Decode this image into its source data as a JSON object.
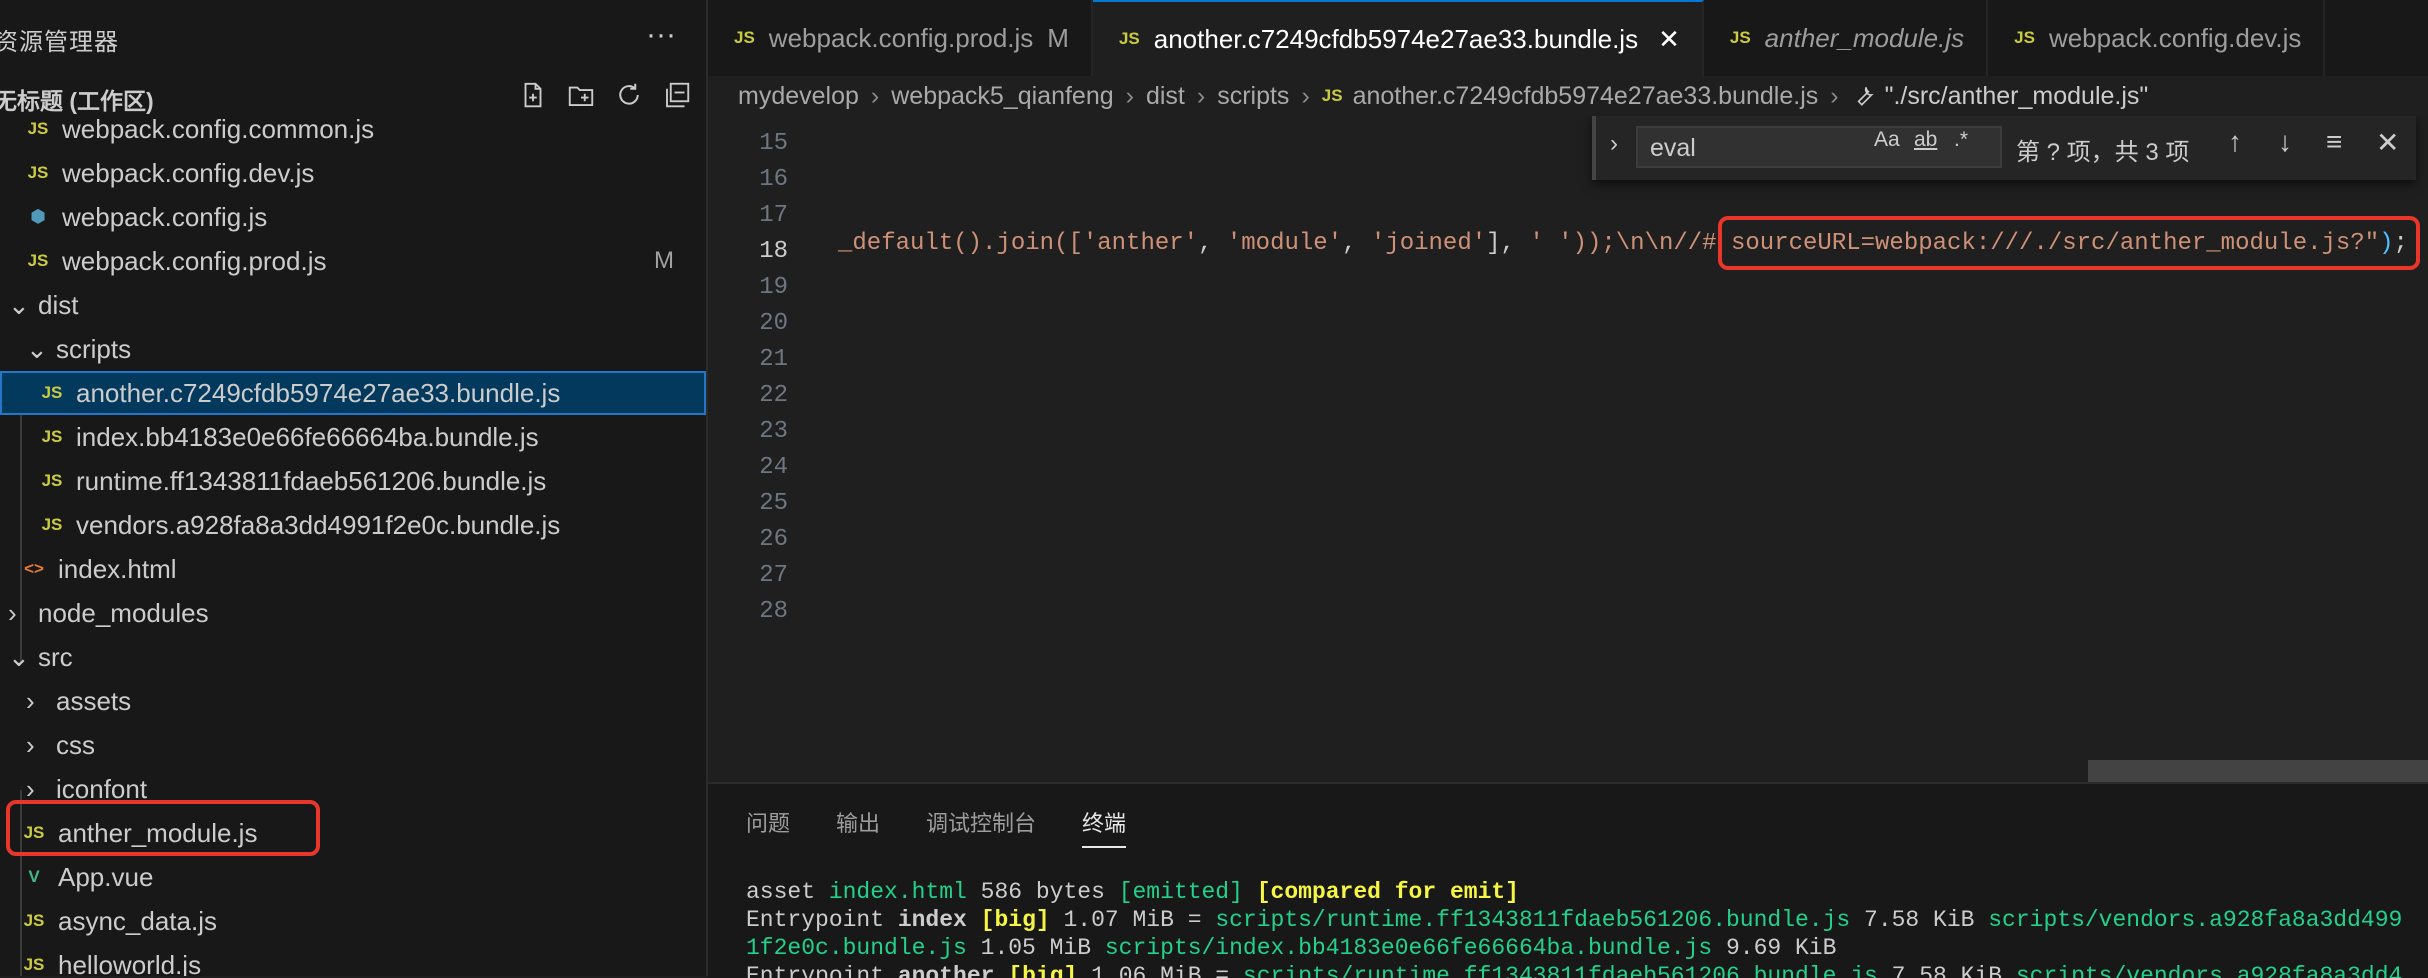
{
  "sidebar": {
    "title": "资源管理器",
    "more": "···",
    "workspace_label": "无标题 (工作区)",
    "items": [
      {
        "label": "webpack.config.common.js",
        "icon": "JS",
        "badge": ""
      },
      {
        "label": "webpack.config.dev.js",
        "icon": "JS",
        "badge": ""
      },
      {
        "label": "webpack.config.js",
        "icon": "gear",
        "badge": ""
      },
      {
        "label": "webpack.config.prod.js",
        "icon": "JS",
        "badge": "M"
      },
      {
        "label": "dist",
        "icon": "chevron-down",
        "badge": ""
      },
      {
        "label": "scripts",
        "icon": "chevron-down",
        "badge": ""
      },
      {
        "label": "another.c7249cfdb5974e27ae33.bundle.js",
        "icon": "JS",
        "badge": ""
      },
      {
        "label": "index.bb4183e0e66fe66664ba.bundle.js",
        "icon": "JS",
        "badge": ""
      },
      {
        "label": "runtime.ff1343811fdaeb561206.bundle.js",
        "icon": "JS",
        "badge": ""
      },
      {
        "label": "vendors.a928fa8a3dd4991f2e0c.bundle.js",
        "icon": "JS",
        "badge": ""
      },
      {
        "label": "index.html",
        "icon": "<>",
        "badge": ""
      },
      {
        "label": "node_modules",
        "icon": "chevron-right",
        "badge": ""
      },
      {
        "label": "src",
        "icon": "chevron-down",
        "badge": ""
      },
      {
        "label": "assets",
        "icon": "chevron-right",
        "badge": ""
      },
      {
        "label": "css",
        "icon": "chevron-right",
        "badge": ""
      },
      {
        "label": "iconfont",
        "icon": "chevron-right",
        "badge": ""
      },
      {
        "label": "anther_module.js",
        "icon": "JS",
        "badge": ""
      },
      {
        "label": "App.vue",
        "icon": "V",
        "badge": ""
      },
      {
        "label": "async_data.js",
        "icon": "JS",
        "badge": ""
      },
      {
        "label": "helloworld.js",
        "icon": "JS",
        "badge": ""
      }
    ]
  },
  "tabs": [
    {
      "label": "webpack.config.prod.js",
      "status": "M"
    },
    {
      "label": "another.c7249cfdb5974e27ae33.bundle.js",
      "close": "✕"
    },
    {
      "label": "anther_module.js"
    },
    {
      "label": "webpack.config.dev.js"
    }
  ],
  "breadcrumb": {
    "parts": [
      "mydevelop",
      "webpack5_qianfeng",
      "dist",
      "scripts"
    ],
    "file": "another.c7249cfdb5974e27ae33.bundle.js",
    "symbol": "\"./src/anther_module.js\""
  },
  "editor": {
    "line_numbers": [
      "15",
      "16",
      "17",
      "18",
      "19",
      "20",
      "21",
      "22",
      "23",
      "24",
      "25",
      "26",
      "27",
      "28"
    ],
    "code": {
      "part1": "_default().join([",
      "s1": "'anther'",
      "c1": ", ",
      "s2": "'module'",
      "c2": ", ",
      "s3": "'joined'",
      "c3": "], ",
      "s4": "' '",
      "c4": "));\\n\\n//# ",
      "highlight": "sourceURL=webpack:///./src/anther_module.js?\"",
      "end_paren": ")",
      "end": ";"
    }
  },
  "find": {
    "value": "eval",
    "case_label": "Aa",
    "word_label": "ab",
    "regex_label": ".*",
    "count": "第 ? 项，共 3 项"
  },
  "panel": {
    "tabs": [
      "问题",
      "输出",
      "调试控制台",
      "终端"
    ],
    "terminal": {
      "l1_a": "asset ",
      "l1_b": "index.html",
      "l1_c": " 586 bytes ",
      "l1_d": "[emitted]",
      "l1_e": " ",
      "l1_f": "[compared for emit]",
      "l2_a": "Entrypoint ",
      "l2_b": "index",
      "l2_c": " ",
      "l2_d": "[big]",
      "l2_e": " 1.07 MiB = ",
      "l2_f": "scripts/runtime.ff1343811fdaeb561206.bundle.js",
      "l2_g": " 7.58 KiB ",
      "l2_h": "scripts/vendors.a928fa8a3dd499",
      "l3_a": "1f2e0c.bundle.js",
      "l3_b": " 1.05 MiB ",
      "l3_c": "scripts/index.bb4183e0e66fe66664ba.bundle.js",
      "l3_d": " 9.69 KiB",
      "l4_a": "Entrypoint ",
      "l4_b": "another",
      "l4_c": " ",
      "l4_d": "[big]",
      "l4_e": " 1.06 MiB = ",
      "l4_f": "scripts/runtime.ff1343811fdaeb561206.bundle.js",
      "l4_g": " 7.58 KiB ",
      "l4_h": "scripts/vendors.a928fa8a3dd4"
    }
  },
  "colors": {
    "accent": "#0078d4",
    "selection": "#04395e",
    "annotation": "#e8362b",
    "js_icon": "#cbcb41",
    "terminal_green": "#23d18b",
    "terminal_yellow": "#f5f543"
  }
}
